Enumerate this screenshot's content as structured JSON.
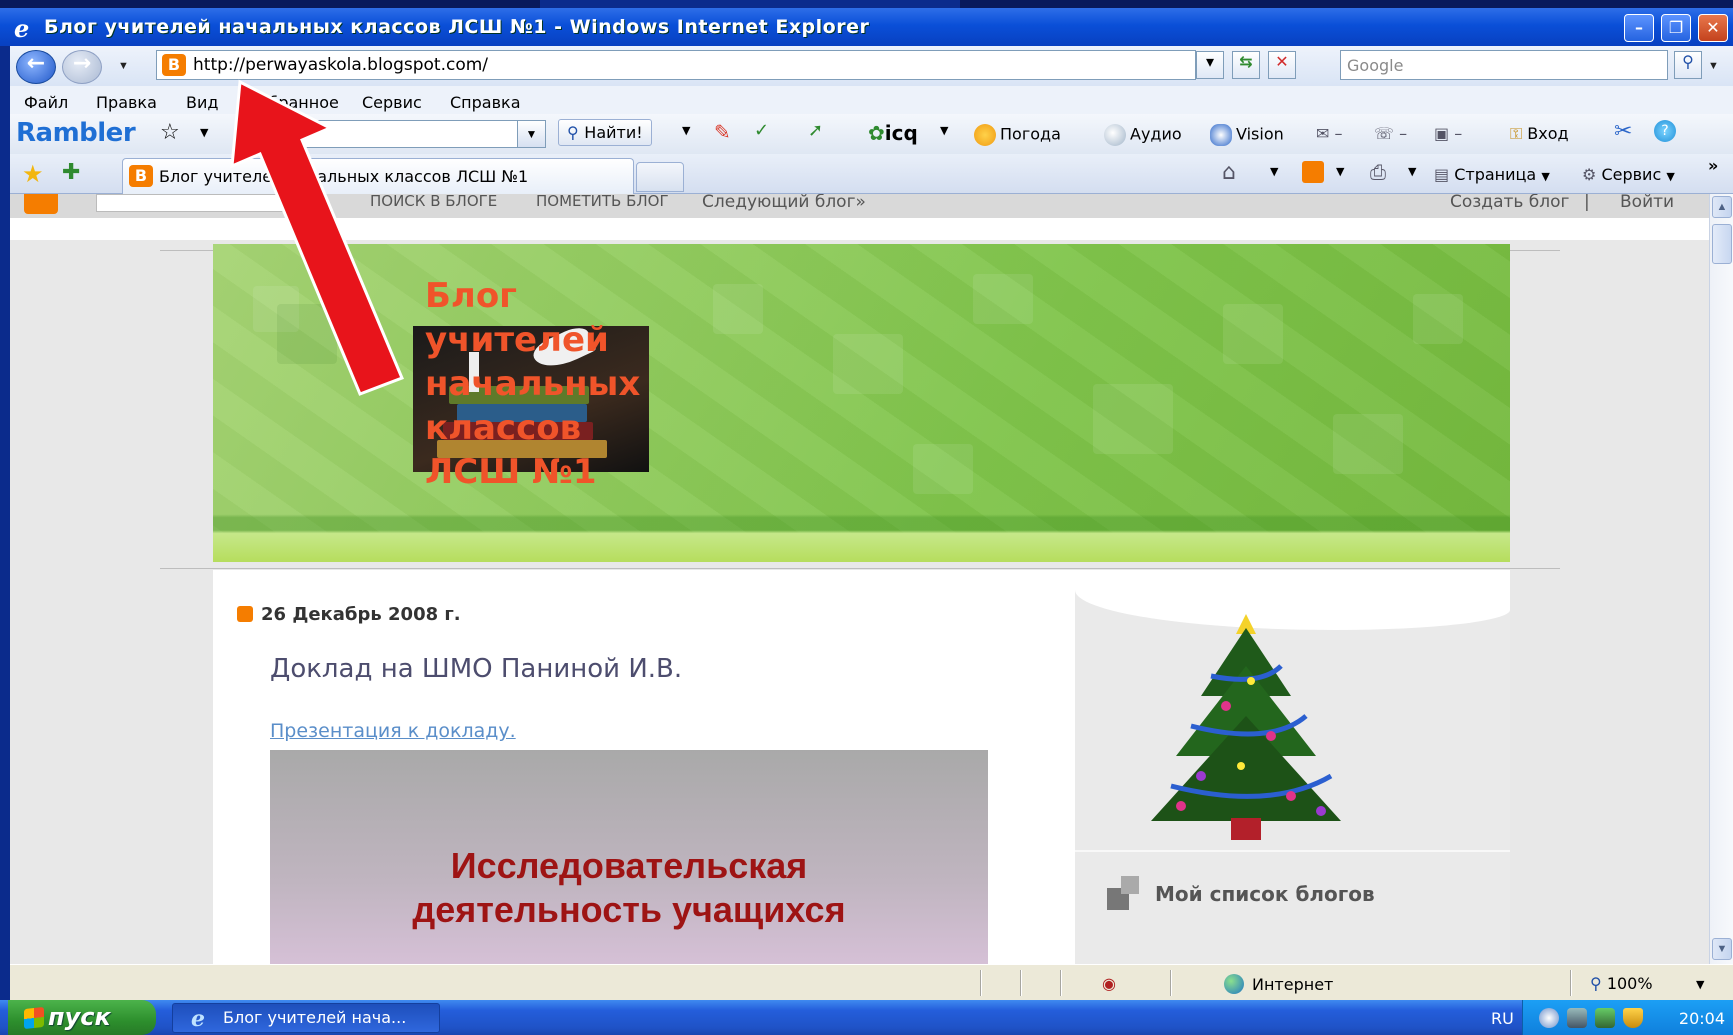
{
  "window": {
    "title": "Блог учителей начальных классов ЛСШ №1 - Windows Internet Explorer"
  },
  "address_bar": {
    "url": "http://perwayaskola.blogspot.com/",
    "search_placeholder": "Google"
  },
  "menu": {
    "items": [
      "Файл",
      "Правка",
      "Вид",
      "Избранное",
      "Сервис",
      "Справка"
    ]
  },
  "rambler_toolbar": {
    "logo": "Rambler",
    "find_label": "Найти!",
    "icq_label": "icq",
    "weather_label": "Погода",
    "audio_label": "Аудио",
    "vision_label": "Vision",
    "login_label": "Вход"
  },
  "tabs": {
    "active_tab_title": "Блог учителей начальных классов ЛСШ №1",
    "page_menu_label": "Страница",
    "service_menu_label": "Сервис"
  },
  "blogger_navbar": {
    "search_blog": "ПОИСК В БЛОГЕ",
    "flag_blog": "ПОМЕТИТЬ БЛОГ",
    "next_blog": "Следующий блог»",
    "create_blog": "Создать блог",
    "login": "Войти"
  },
  "blog": {
    "header_title": "Блог\nучителей\nначальных\nклассов\nЛСШ №1",
    "post_date": "26 Декабрь 2008 г.",
    "post_title": "Доклад на ШМО Паниной И.В.",
    "post_link": "Презентация к докладу.",
    "slide_text": "Исследовательская\nдеятельность учащихся",
    "sidebar_heading": "Мой список блогов"
  },
  "status_bar": {
    "zone": "Интернет",
    "zoom": "100%"
  },
  "taskbar": {
    "start_label": "пуск",
    "task_item": "Блог учителей нача...",
    "lang": "RU",
    "clock": "20:04"
  },
  "colors": {
    "annotation_arrow": "#e8141b",
    "header_title": "#f0542a",
    "header_green": "#7fc44a",
    "slide_text": "#9e1414",
    "link": "#5a8ec9"
  }
}
